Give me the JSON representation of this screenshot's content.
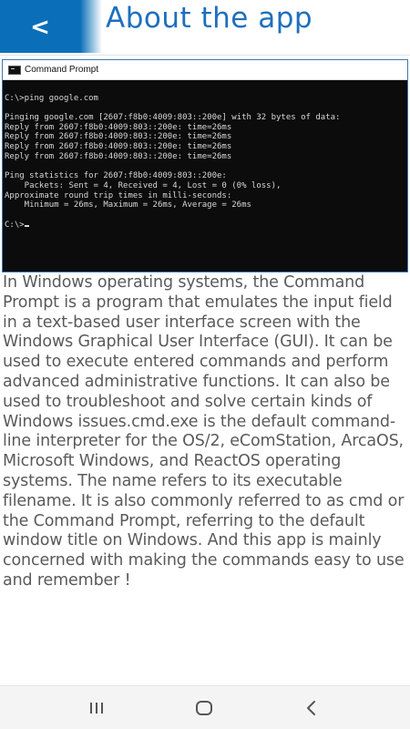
{
  "app_bar": {
    "title": "About the app",
    "back_glyph": "<",
    "accent_color": "#0a6fb8"
  },
  "cmd_window": {
    "title": "Command Prompt",
    "lines": [
      "",
      "C:\\>ping google.com",
      "",
      "Pinging google.com [2607:f8b0:4009:803::200e] with 32 bytes of data:",
      "Reply from 2607:f8b0:4009:803::200e: time=26ms",
      "Reply from 2607:f8b0:4009:803::200e: time=26ms",
      "Reply from 2607:f8b0:4009:803::200e: time=26ms",
      "Reply from 2607:f8b0:4009:803::200e: time=26ms",
      "",
      "Ping statistics for 2607:f8b0:4009:803::200e:",
      "    Packets: Sent = 4, Received = 4, Lost = 0 (0% loss),",
      "Approximate round trip times in milli-seconds:",
      "    Minimum = 26ms, Maximum = 26ms, Average = 26ms",
      "",
      "C:\\>"
    ]
  },
  "description": "In Windows operating systems, the Command Prompt is a program that emulates the input field in a text-based user interface screen with the Windows Graphical User Interface (GUI). It can be used to execute entered commands and perform advanced administrative functions. It can also be used to troubleshoot and solve certain kinds of Windows issues.cmd.exe is the default command-line interpreter for the OS/2, eComStation, ArcaOS, Microsoft Windows, and ReactOS operating systems. The name refers to its executable filename. It is also commonly referred to as cmd or the Command Prompt, referring to the default window title on Windows. And this app is mainly concerned with making the commands easy to use and remember !",
  "nav_bar": {
    "recent_icon": "recent-apps-icon",
    "home_icon": "home-icon",
    "back_icon": "back-icon"
  }
}
